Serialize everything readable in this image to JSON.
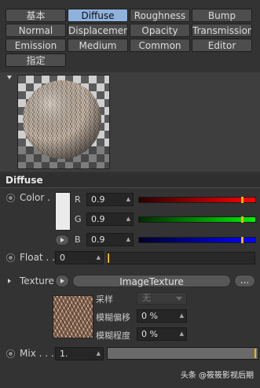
{
  "tabs": {
    "rows": [
      [
        "基本",
        "Diffuse",
        "Roughness",
        "Bump"
      ],
      [
        "Normal",
        "Displacement",
        "Opacity",
        "Transmission"
      ],
      [
        "Emission",
        "Medium",
        "Common",
        "Editor"
      ],
      [
        "指定"
      ]
    ],
    "active": "Diffuse"
  },
  "section_title": "Diffuse",
  "color": {
    "label": "Color",
    "swatch": "#ebebeb",
    "channels": [
      {
        "name": "R",
        "value": "0.9",
        "fraction": 0.9,
        "gradient_from": "#2a0000",
        "gradient_to": "#ff0000"
      },
      {
        "name": "G",
        "value": "0.9",
        "fraction": 0.9,
        "gradient_from": "#002a00",
        "gradient_to": "#00ee00"
      },
      {
        "name": "B",
        "value": "0.9",
        "fraction": 0.9,
        "gradient_from": "#00002a",
        "gradient_to": "#0000ff"
      }
    ]
  },
  "float": {
    "label": "Float",
    "value": "0",
    "fraction": 0.0
  },
  "texture": {
    "label": "Texture",
    "button": "ImageTexture",
    "more": "...",
    "sample_label": "采样",
    "sample_value": "无",
    "blur_offset_label": "模糊偏移",
    "blur_offset_value": "0 %",
    "blur_amount_label": "模糊程度",
    "blur_amount_value": "0 %"
  },
  "mix": {
    "label": "Mix",
    "value": "1.",
    "fraction": 1.0
  },
  "watermark": "头条 @筱筱影视后期",
  "accent": "#ffb400"
}
